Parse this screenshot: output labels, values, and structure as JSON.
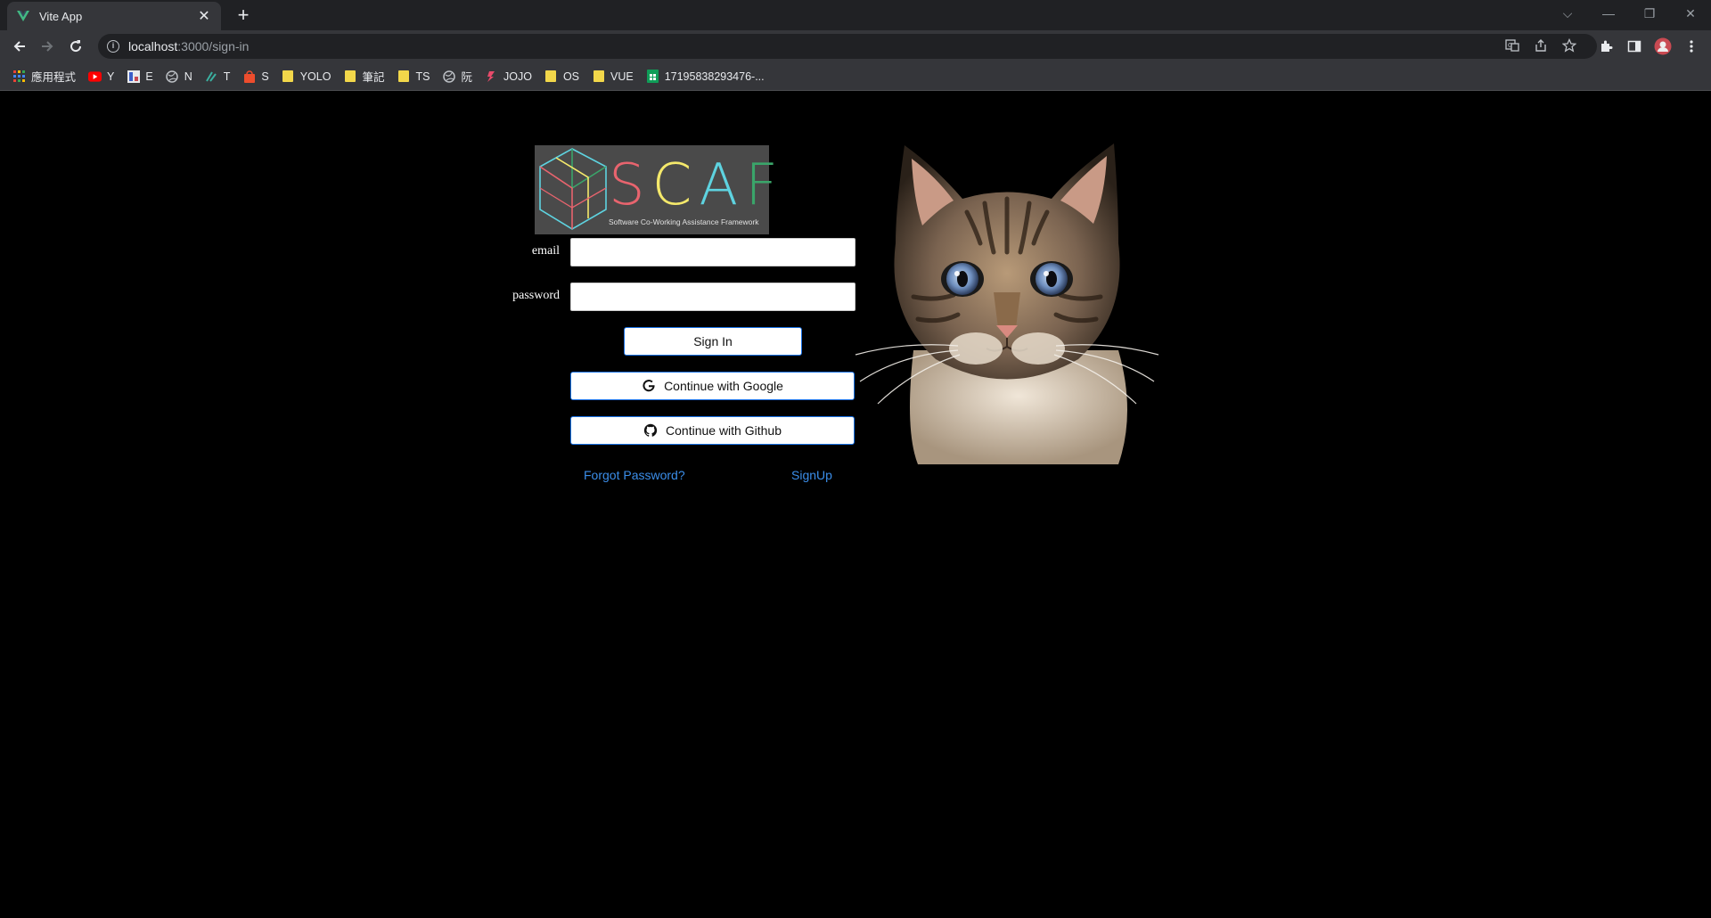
{
  "browser": {
    "tab_title": "Vite App",
    "tab_close": "✕",
    "new_tab": "+",
    "url_host": "localhost",
    "url_path": ":3000/sign-in",
    "window_controls": [
      "⌵",
      "—",
      "❐",
      "✕"
    ]
  },
  "bookmarks": [
    {
      "label": "應用程式",
      "icon": "apps-grid-icon"
    },
    {
      "label": "Y",
      "icon": "youtube-icon"
    },
    {
      "label": "E",
      "icon": "e-site-icon"
    },
    {
      "label": "N",
      "icon": "globe-icon"
    },
    {
      "label": "T",
      "icon": "t-site-icon"
    },
    {
      "label": "S",
      "icon": "shop-icon"
    },
    {
      "label": "YOLO",
      "icon": "folder-icon"
    },
    {
      "label": "筆記",
      "icon": "folder-icon"
    },
    {
      "label": "TS",
      "icon": "folder-icon"
    },
    {
      "label": "阮",
      "icon": "globe-icon"
    },
    {
      "label": "JOJO",
      "icon": "jojo-icon"
    },
    {
      "label": "OS",
      "icon": "folder-icon"
    },
    {
      "label": "VUE",
      "icon": "folder-icon"
    },
    {
      "label": "17195838293476-...",
      "icon": "sheets-icon"
    }
  ],
  "logo": {
    "text": "SCAF",
    "subtitle": "Software Co-Working Assistance Framework",
    "letter_colors": [
      "#e8646e",
      "#f5e96b",
      "#5ed3e0",
      "#3aa56a"
    ]
  },
  "form": {
    "email_label": "email",
    "email_value": "",
    "password_label": "password",
    "password_value": "",
    "sign_in_label": "Sign In",
    "google_label": "Continue with Google",
    "github_label": "Continue with Github",
    "forgot_label": "Forgot Password?",
    "signup_label": "SignUp"
  },
  "colors": {
    "accent_link": "#3b8eea",
    "button_border": "#1a73e8",
    "page_bg": "#000000"
  }
}
